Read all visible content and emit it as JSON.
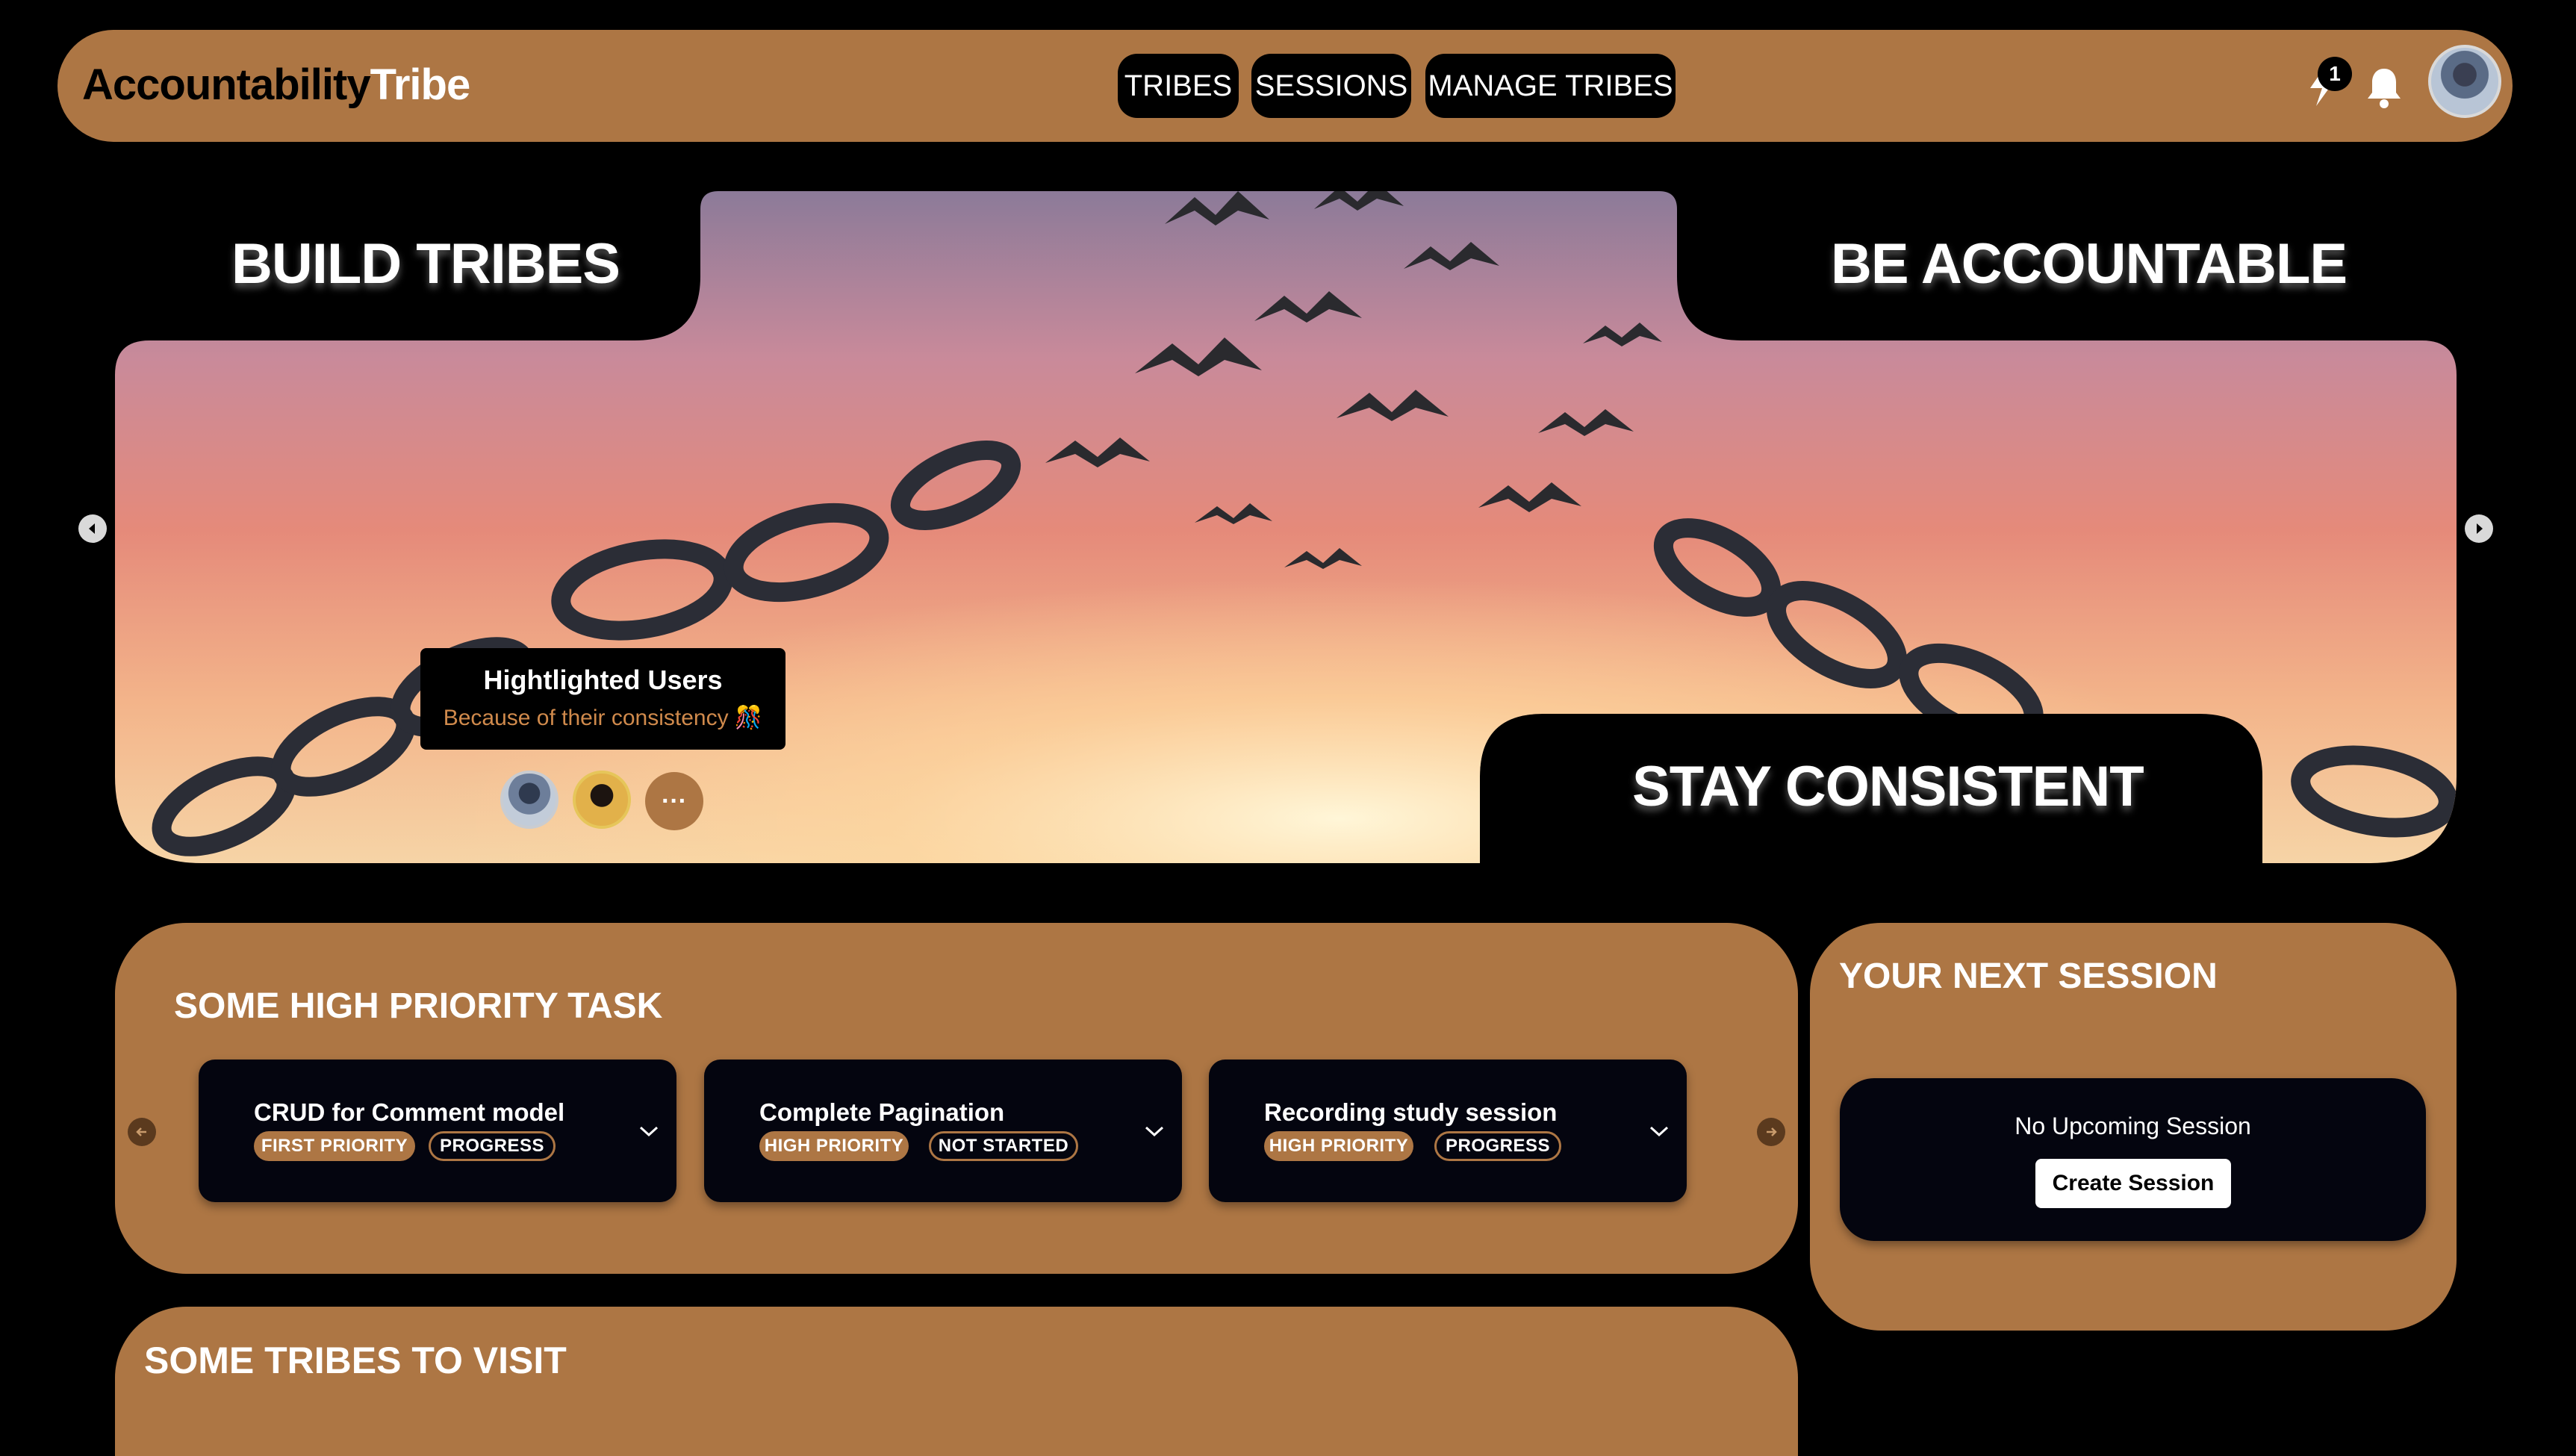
{
  "header": {
    "brand_part1": "Accountability",
    "brand_part2": "Tribe",
    "nav": [
      "TRIBES",
      "SESSIONS",
      "MANAGE TRIBES"
    ],
    "notification_count": "1",
    "icons": [
      "flash-icon",
      "bell-icon"
    ]
  },
  "hero": {
    "left_label": "BUILD TRIBES",
    "right_label": "BE ACCOUNTABLE",
    "bottom_label": "STAY CONSISTENT",
    "highlight": {
      "title": "Hightlighted Users",
      "subtitle": "Because of their consistency 🎊",
      "more_label": "···"
    }
  },
  "tasks": {
    "title": "SOME HIGH PRIORITY TASK",
    "items": [
      {
        "title": "CRUD for Comment model",
        "priority": "FIRST PRIORITY",
        "status": "PROGRESS"
      },
      {
        "title": "Complete Pagination",
        "priority": "HIGH PRIORITY",
        "status": "NOT STARTED"
      },
      {
        "title": "Recording study session",
        "priority": "HIGH PRIORITY",
        "status": "PROGRESS"
      }
    ]
  },
  "session": {
    "title": "YOUR NEXT SESSION",
    "empty_text": "No Upcoming Session",
    "create_label": "Create Session"
  },
  "tribes": {
    "title": "SOME TRIBES TO VISIT"
  },
  "colors": {
    "accent": "#ad7644",
    "background": "#000000",
    "card": "#04050f",
    "subtitle": "#d08a4c"
  }
}
